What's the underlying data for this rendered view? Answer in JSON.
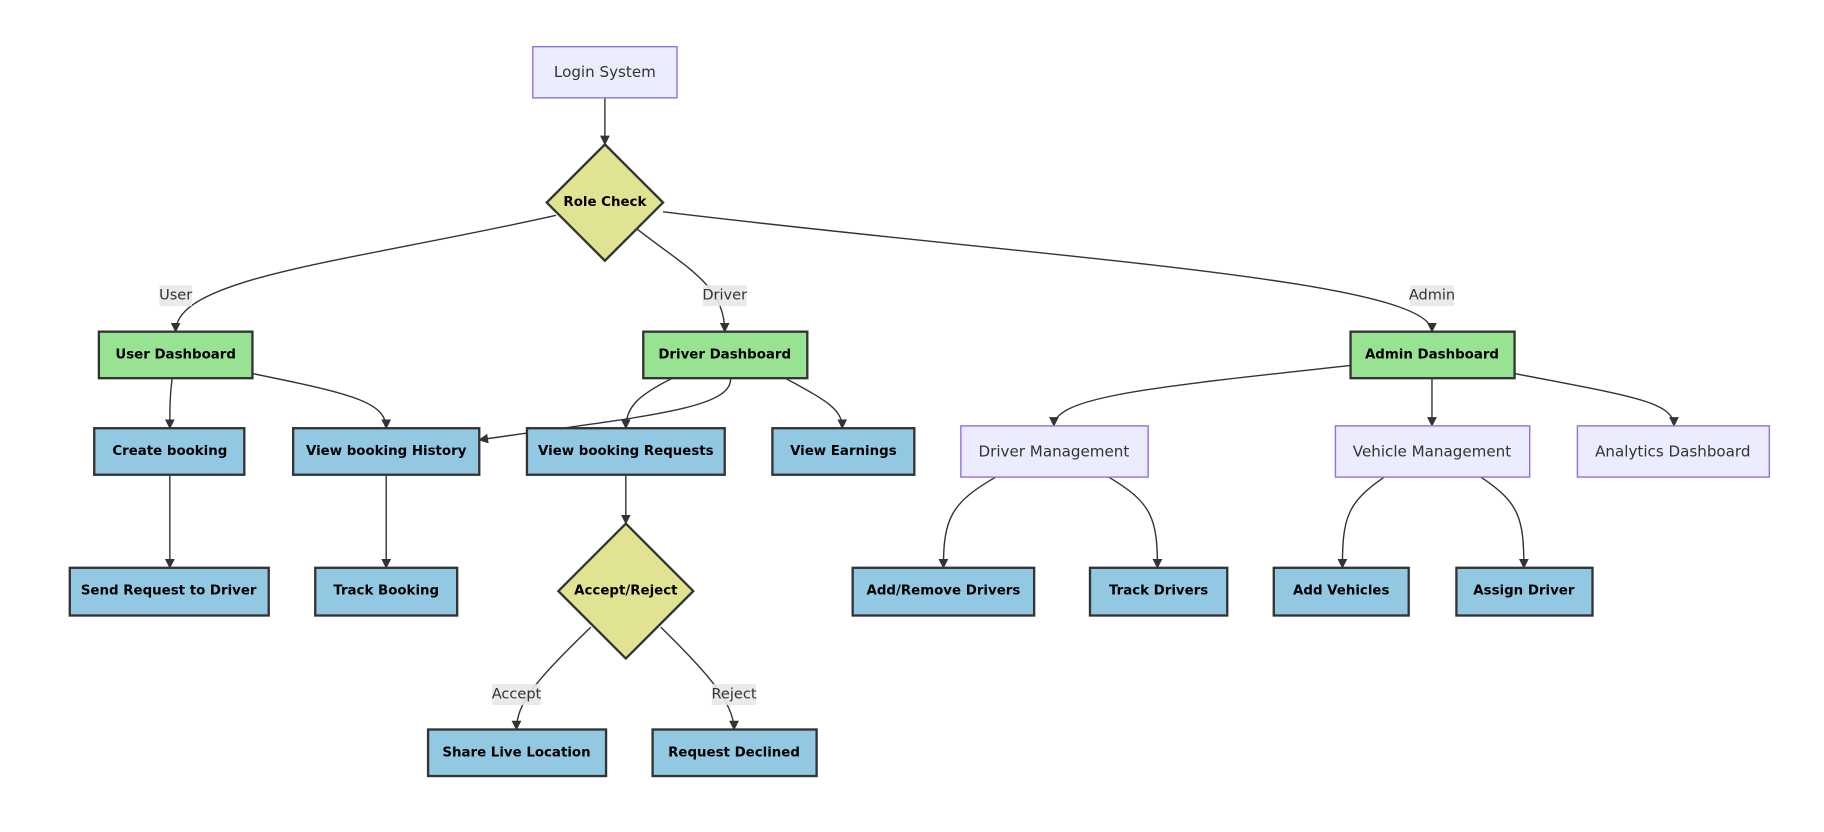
{
  "diagram": {
    "type": "flowchart",
    "colors": {
      "default_fill": "#ECECFF",
      "default_stroke": "#9370DB",
      "dashboard_fill": "#98E392",
      "action_fill": "#93C8E3",
      "decision_fill": "#E0E391",
      "edge": "#333333"
    },
    "nodes": {
      "login": "Login System",
      "role_check": "Role Check",
      "user_dashboard": "User Dashboard",
      "driver_dashboard": "Driver Dashboard",
      "admin_dashboard": "Admin Dashboard",
      "create_booking": "Create booking",
      "view_history": "View booking History",
      "view_requests": "View booking Requests",
      "view_earnings": "View Earnings",
      "driver_management": "Driver Management",
      "vehicle_management": "Vehicle Management",
      "analytics_dashboard": "Analytics Dashboard",
      "send_request": "Send Request to Driver",
      "track_booking": "Track Booking",
      "accept_reject": "Accept/Reject",
      "add_remove_drivers": "Add/Remove Drivers",
      "track_drivers": "Track Drivers",
      "add_vehicles": "Add Vehicles",
      "assign_driver": "Assign Driver",
      "share_location": "Share Live Location",
      "request_declined": "Request Declined"
    },
    "edge_labels": {
      "user": "User",
      "driver": "Driver",
      "admin": "Admin",
      "accept": "Accept",
      "reject": "Reject"
    }
  }
}
